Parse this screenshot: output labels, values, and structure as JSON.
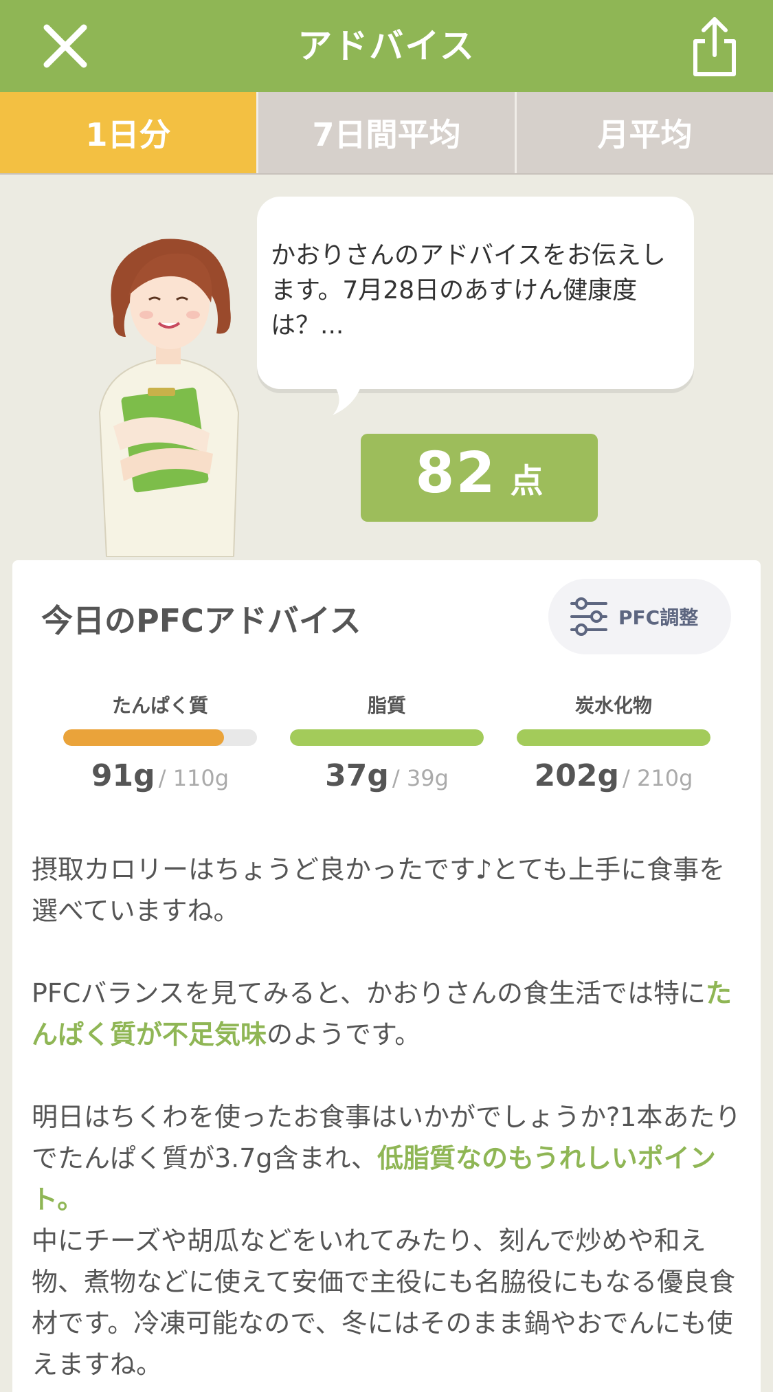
{
  "header": {
    "title": "アドバイス",
    "close_icon": "close-icon",
    "share_icon": "share-icon"
  },
  "tabs": [
    {
      "label": "1日分",
      "active": true
    },
    {
      "label": "7日間平均",
      "active": false
    },
    {
      "label": "月平均",
      "active": false
    }
  ],
  "advisor": {
    "message": "かおりさんのアドバイスをお伝えします。7月28日のあすけん健康度は？...",
    "score": "82",
    "score_unit": "点"
  },
  "pfc": {
    "title": "今日のPFCアドバイス",
    "adjust_label": "PFC調整",
    "nutrients": [
      {
        "label": "たんぱく質",
        "actual": "91g",
        "target": "/ 110g",
        "ratio": 0.83,
        "color": "#eaa33a"
      },
      {
        "label": "脂質",
        "actual": "37g",
        "target": "/ 39g",
        "ratio": 1.0,
        "color": "#a3cb5a"
      },
      {
        "label": "炭水化物",
        "actual": "202g",
        "target": "/ 210g",
        "ratio": 1.0,
        "color": "#a3cb5a"
      }
    ]
  },
  "advice": {
    "p1": "摂取カロリーはちょうど良かったです♪とても上手に食事を選べていますね。",
    "p2_pre": "PFCバランスを見てみると、かおりさんの食生活では特に",
    "p2_hl": "たんぱく質が不足気味",
    "p2_post": "のようです。",
    "p3_pre": "明日はちくわを使ったお食事はいかがでしょうか?1本あたりでたんぱく質が3.7g含まれ、",
    "p3_hl": "低脂質なのもうれしいポイント。",
    "p4": "中にチーズや胡瓜などをいれてみたり、刻んで炒めや和え物、煮物などに使えて安価で主役にも名脇役にもなる優良食材です。冷凍可能なので、冬にはそのまま鍋やおでんにも使えますね。"
  },
  "colors": {
    "header_green": "#8fb655",
    "tab_active": "#f3c042",
    "score_green": "#9dbd5b",
    "highlight_green": "#8fb655"
  }
}
